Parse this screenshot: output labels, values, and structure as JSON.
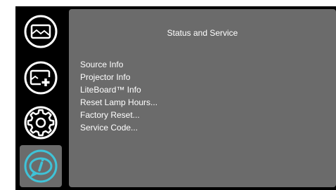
{
  "panel": {
    "title": "Status and Service"
  },
  "menu": {
    "items": [
      {
        "label": "Source Info"
      },
      {
        "label": "Projector Info"
      },
      {
        "label": "LiteBoard™ Info"
      },
      {
        "label": "Reset Lamp Hours..."
      },
      {
        "label": "Factory Reset..."
      },
      {
        "label": "Service Code..."
      }
    ]
  },
  "sidebar": {
    "tabs": [
      {
        "icon": "picture-icon",
        "selected": false
      },
      {
        "icon": "picture-plus-icon",
        "selected": false
      },
      {
        "icon": "gear-icon",
        "selected": false
      },
      {
        "icon": "info-icon",
        "selected": true
      }
    ]
  },
  "colors": {
    "background": "#000000",
    "panel": "#6b6b6b",
    "selected_tab": "#6b6b6b",
    "icon_default": "#ffffff",
    "icon_selected": "#3fc3d8"
  }
}
